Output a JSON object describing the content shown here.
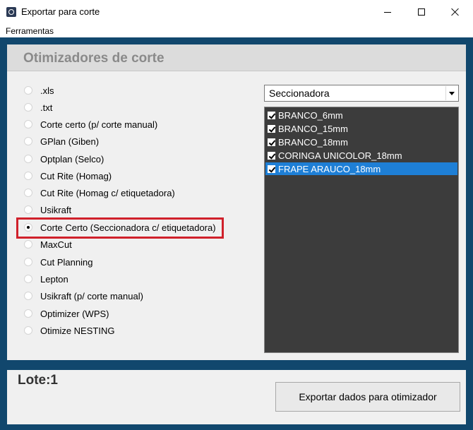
{
  "window": {
    "title": "Exportar para corte",
    "icon": "app-icon",
    "controls": [
      "minimize-icon",
      "maximize-icon",
      "close-icon"
    ]
  },
  "menu": {
    "items": [
      {
        "label": "Ferramentas"
      }
    ]
  },
  "panel": {
    "title": "Otimizadores de corte"
  },
  "options": [
    {
      "label": ".xls",
      "checked": false
    },
    {
      "label": ".txt",
      "checked": false
    },
    {
      "label": "Corte certo (p/ corte manual)",
      "checked": false
    },
    {
      "label": "GPlan (Giben)",
      "checked": false
    },
    {
      "label": "Optplan (Selco)",
      "checked": false
    },
    {
      "label": "Cut Rite (Homag)",
      "checked": false
    },
    {
      "label": "Cut Rite (Homag c/ etiquetadora)",
      "checked": false
    },
    {
      "label": "Usikraft",
      "checked": false
    },
    {
      "label": "Corte Certo (Seccionadora c/ etiquetadora)",
      "checked": true
    },
    {
      "label": "MaxCut",
      "checked": false
    },
    {
      "label": "Cut Planning",
      "checked": false
    },
    {
      "label": "Lepton",
      "checked": false
    },
    {
      "label": "Usikraft (p/ corte manual)",
      "checked": false
    },
    {
      "label": "Optimizer (WPS)",
      "checked": false
    },
    {
      "label": "Otimize NESTING",
      "checked": false
    }
  ],
  "machine_select": {
    "value": "Seccionadora"
  },
  "materials": [
    {
      "label": "BRANCO_6mm",
      "checked": true,
      "selected": false
    },
    {
      "label": "BRANCO_15mm",
      "checked": true,
      "selected": false
    },
    {
      "label": "BRANCO_18mm",
      "checked": true,
      "selected": false
    },
    {
      "label": "CORINGA UNICOLOR_18mm",
      "checked": true,
      "selected": false
    },
    {
      "label": "FRAPE ARAUCO_18mm",
      "checked": true,
      "selected": true
    }
  ],
  "footer": {
    "lote": "Lote:1",
    "export_label": "Exportar dados para otimizador"
  },
  "colors": {
    "frame": "#11476d",
    "highlight": "#d0212b",
    "selection": "#1e7fd6",
    "listbox_bg": "#3c3c3c"
  }
}
